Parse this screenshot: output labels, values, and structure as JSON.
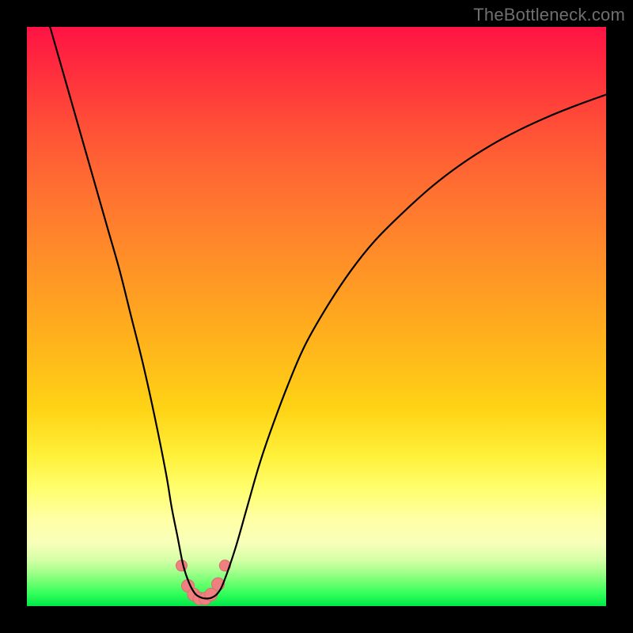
{
  "watermark": "TheBottleneck.com",
  "colors": {
    "frame": "#000000",
    "curve": "#000000",
    "marker_fill": "#f08080",
    "marker_stroke": "#d86f6f"
  },
  "chart_data": {
    "type": "line",
    "title": "",
    "xlabel": "",
    "ylabel": "",
    "xlim": [
      0,
      100
    ],
    "ylim": [
      0,
      100
    ],
    "grid": false,
    "legend": false,
    "series": [
      {
        "name": "bottleneck-curve",
        "x": [
          4,
          6,
          8,
          10,
          12,
          14,
          16,
          18,
          20,
          22,
          24,
          25,
          26,
          27,
          28,
          29,
          30,
          31,
          32,
          33,
          34,
          36,
          38,
          40,
          42,
          45,
          48,
          52,
          56,
          60,
          65,
          70,
          75,
          80,
          85,
          90,
          95,
          100
        ],
        "y": [
          100,
          93,
          86,
          79,
          72,
          65,
          58,
          50,
          42,
          33,
          23,
          17,
          12,
          7,
          4,
          2.2,
          1.5,
          1.3,
          1.5,
          2.3,
          4.2,
          10,
          17,
          24,
          30,
          38,
          45,
          52,
          58,
          63,
          68,
          72.5,
          76.3,
          79.5,
          82.2,
          84.5,
          86.5,
          88.3
        ]
      }
    ],
    "markers": {
      "name": "optimal-range",
      "x": [
        26.7,
        27.8,
        28.8,
        29.8,
        30.8,
        31.8,
        33.0,
        34.2
      ],
      "y": [
        7.0,
        3.5,
        2.0,
        1.3,
        1.3,
        2.0,
        3.8,
        7.0
      ],
      "r": [
        7,
        8,
        8,
        8,
        8,
        8,
        8,
        7
      ]
    }
  }
}
